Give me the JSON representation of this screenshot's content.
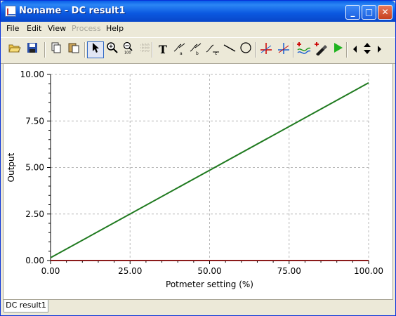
{
  "window": {
    "title": "Noname - DC result1"
  },
  "menu": [
    {
      "label": "File",
      "enabled": true
    },
    {
      "label": "Edit",
      "enabled": true
    },
    {
      "label": "View",
      "enabled": true
    },
    {
      "label": "Process",
      "enabled": false
    },
    {
      "label": "Help",
      "enabled": true
    }
  ],
  "toolbar": {
    "tools": [
      "open-icon",
      "save-icon",
      "copy-icon",
      "paste-icon",
      "pointer-icon",
      "zoom-in-icon",
      "zoom-100-icon",
      "grid-icon",
      "text-icon",
      "label-a-icon",
      "label-b-icon",
      "label-c-icon",
      "line-icon",
      "ellipse-icon",
      "cursor-a-icon",
      "cursor-b-icon",
      "add-trace-icon",
      "pick-color-icon",
      "run-icon",
      "scroll-left-icon",
      "scroll-updown-icon",
      "scroll-right-icon"
    ],
    "text_tool_glyph": "T"
  },
  "chart_data": {
    "type": "line",
    "xlabel": "Potmeter setting (%)",
    "ylabel": "Output",
    "xlim": [
      0,
      100
    ],
    "ylim": [
      0,
      10
    ],
    "x_ticks": [
      "0.00",
      "25.00",
      "50.00",
      "75.00",
      "100.00"
    ],
    "y_ticks": [
      "0.00",
      "2.50",
      "5.00",
      "7.50",
      "10.00"
    ],
    "grid": true,
    "series": [
      {
        "color": "#1f7a1f",
        "x": [
          0,
          100
        ],
        "y": [
          0.15,
          9.55
        ]
      },
      {
        "color": "#8b1a1a",
        "x": [
          0,
          100
        ],
        "y": [
          0,
          0
        ]
      }
    ]
  },
  "tabs": [
    {
      "label": "DC result1",
      "active": true
    }
  ]
}
